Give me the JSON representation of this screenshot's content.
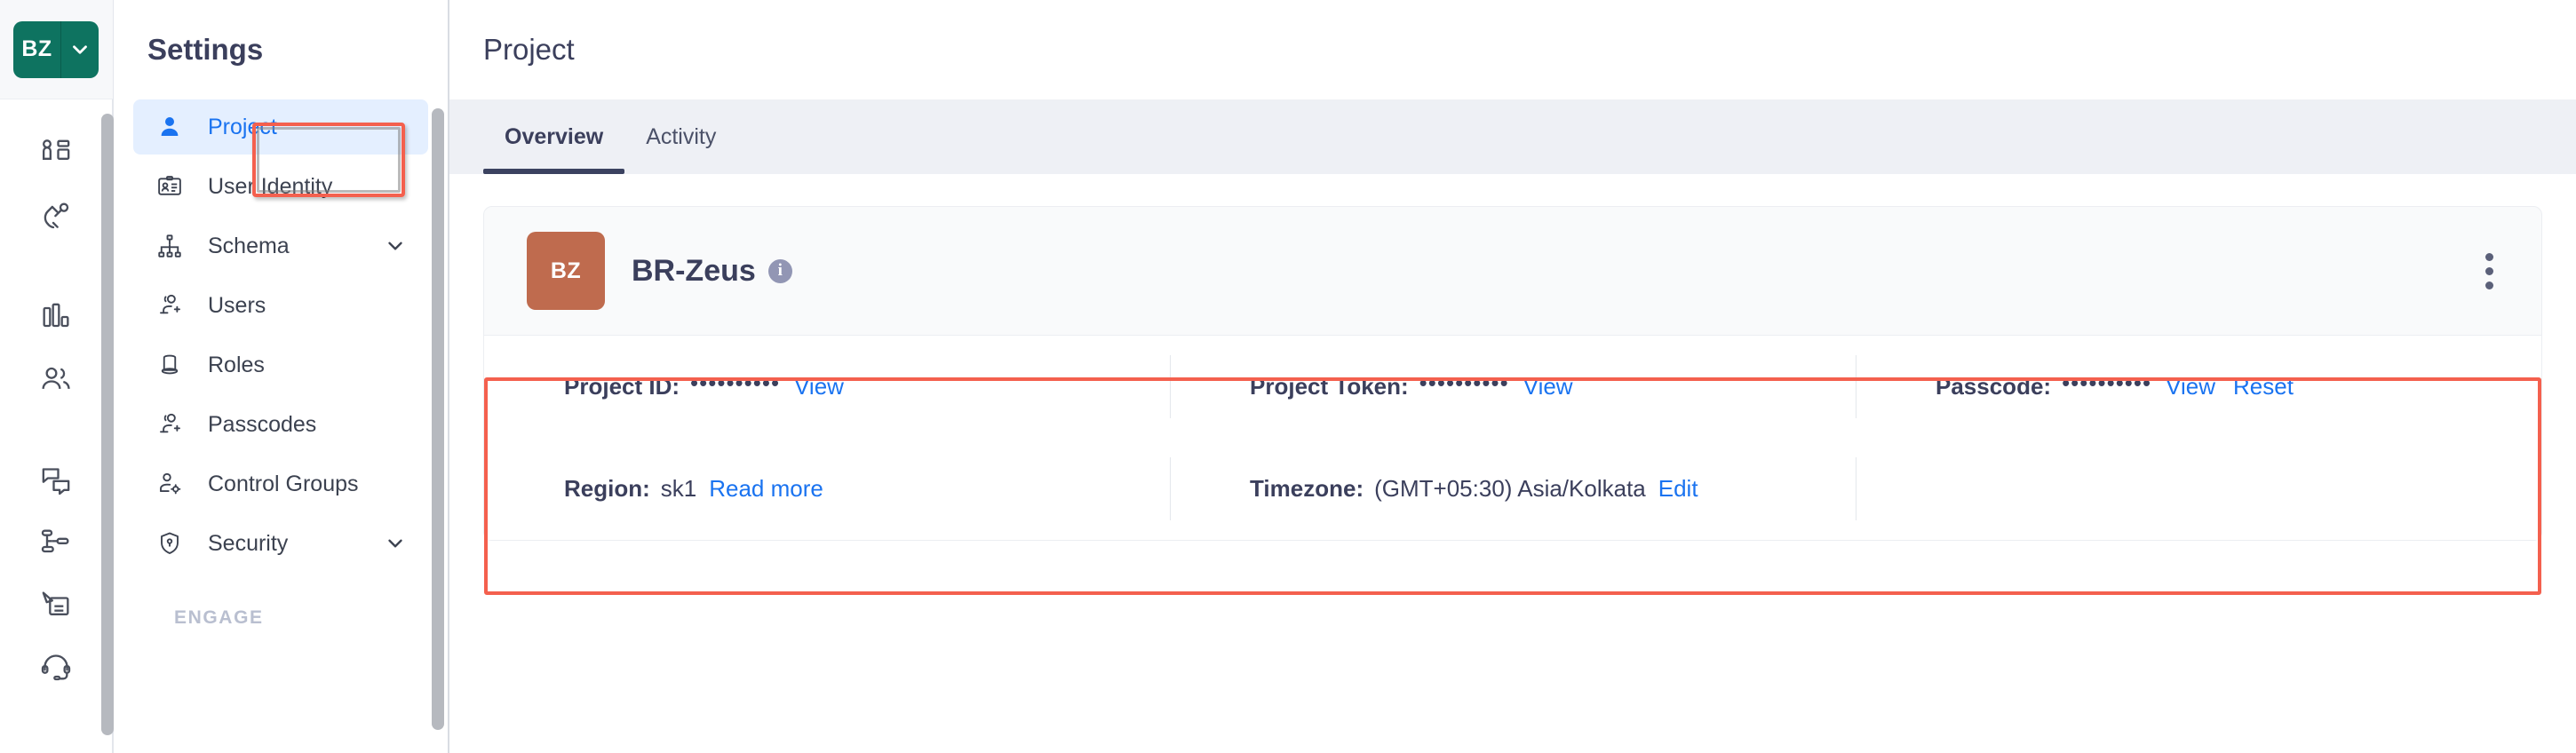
{
  "rail": {
    "brand": {
      "initials": "BZ",
      "caret_icon": "chevron-down-icon",
      "color": "#0E7360"
    },
    "icons": [
      {
        "name": "dashboard-icon"
      },
      {
        "name": "magnet-icon"
      },
      {
        "name": "bar-chart-icon"
      },
      {
        "name": "people-icon"
      },
      {
        "name": "chat-icon"
      },
      {
        "name": "workflow-icon"
      },
      {
        "name": "campaign-icon"
      },
      {
        "name": "headset-support-icon"
      }
    ]
  },
  "sidebar": {
    "title": "Settings",
    "items": [
      {
        "label": "Project",
        "icon": "person-icon",
        "active": true,
        "expandable": false
      },
      {
        "label": "User Identity",
        "icon": "id-card-icon",
        "active": false,
        "expandable": false
      },
      {
        "label": "Schema",
        "icon": "schema-tree-icon",
        "active": false,
        "expandable": true
      },
      {
        "label": "Users",
        "icon": "add-user-icon",
        "active": false,
        "expandable": false
      },
      {
        "label": "Roles",
        "icon": "top-hat-icon",
        "active": false,
        "expandable": false
      },
      {
        "label": "Passcodes",
        "icon": "add-user-icon",
        "active": false,
        "expandable": false
      },
      {
        "label": "Control Groups",
        "icon": "user-settings-icon",
        "active": false,
        "expandable": false
      },
      {
        "label": "Security",
        "icon": "shield-lock-icon",
        "active": false,
        "expandable": true
      }
    ],
    "section_label": "ENGAGE"
  },
  "header": {
    "title": "Project"
  },
  "tabs": [
    {
      "label": "Overview",
      "active": true
    },
    {
      "label": "Activity",
      "active": false
    }
  ],
  "card": {
    "avatar_initials": "BZ",
    "avatar_color": "#BF6B4E",
    "project_name": "BR-Zeus",
    "info_icon": "info-icon",
    "menu_icon": "kebab-menu-icon",
    "rows": [
      [
        {
          "label": "Project ID:",
          "masked": "••••••••••",
          "value": "",
          "links": [
            "View"
          ]
        },
        {
          "label": "Project Token:",
          "masked": "••••••••••",
          "value": "",
          "links": [
            "View"
          ]
        },
        {
          "label": "Passcode:",
          "masked": "••••••••••",
          "value": "",
          "links": [
            "View",
            "Reset"
          ]
        }
      ],
      [
        {
          "label": "Region:",
          "masked": "",
          "value": "sk1",
          "links": [
            "Read more"
          ]
        },
        {
          "label": "Timezone:",
          "masked": "",
          "value": "(GMT+05:30) Asia/Kolkata",
          "links": [
            "Edit"
          ]
        },
        {
          "label": "",
          "masked": "",
          "value": "",
          "links": []
        }
      ]
    ]
  },
  "highlight_color": "#f4604e",
  "accent_link_color": "#1a73f0"
}
